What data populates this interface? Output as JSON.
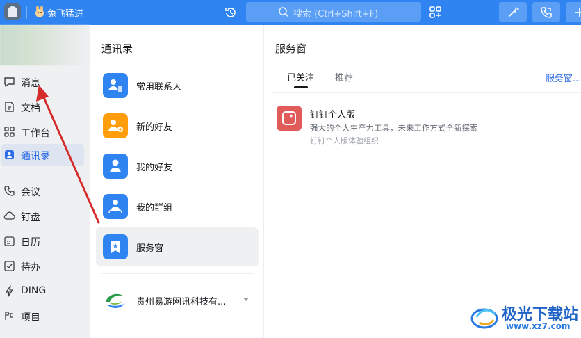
{
  "topbar": {
    "team_name": "兔飞猛进",
    "search_placeholder": "搜索 (Ctrl+Shift+F)",
    "icons": [
      "app-icon",
      "rabbit-logo",
      "history-icon",
      "search-icon",
      "apps-icon",
      "magic-wand-icon",
      "phone-icon",
      "plus-icon"
    ],
    "accent_color": "#2f84f2"
  },
  "leftnav": {
    "items": [
      {
        "label": "消息",
        "icon": "message-icon"
      },
      {
        "label": "文档",
        "icon": "document-icon"
      },
      {
        "label": "工作台",
        "icon": "workbench-icon"
      },
      {
        "label": "通讯录",
        "icon": "contacts-icon",
        "active": true
      },
      {
        "label": "会议",
        "icon": "meeting-icon"
      },
      {
        "label": "钉盘",
        "icon": "cloud-drive-icon"
      },
      {
        "label": "日历",
        "icon": "calendar-icon"
      },
      {
        "label": "待办",
        "icon": "todo-icon"
      },
      {
        "label": "DING",
        "icon": "ding-icon"
      },
      {
        "label": "项目",
        "icon": "project-icon"
      }
    ],
    "active_color": "#2f6ee8"
  },
  "contacts": {
    "title": "通讯录",
    "items": [
      {
        "label": "常用联系人",
        "color": "#2f84f2"
      },
      {
        "label": "新的好友",
        "color": "#ff9d0a"
      },
      {
        "label": "我的好友",
        "color": "#2f84f2"
      },
      {
        "label": "我的群组",
        "color": "#2f84f2"
      },
      {
        "label": "服务窗",
        "color": "#2f84f2",
        "selected": true
      }
    ],
    "org": {
      "name": "贵州易游网讯科技有..."
    }
  },
  "service": {
    "title": "服务窗",
    "tabs": [
      "已关注",
      "推荐"
    ],
    "link": "服务窗...",
    "item": {
      "name": "钉钉个人版",
      "description": "强大的个人生产力工具，未来工作方式全新探索",
      "sub": "钉钉个人版体验组织",
      "color": "#e25b5b"
    }
  },
  "watermark": {
    "text": "极光下载站",
    "url": "www.xz7.com"
  },
  "annotation": {
    "arrow_color": "#d62b2b"
  }
}
